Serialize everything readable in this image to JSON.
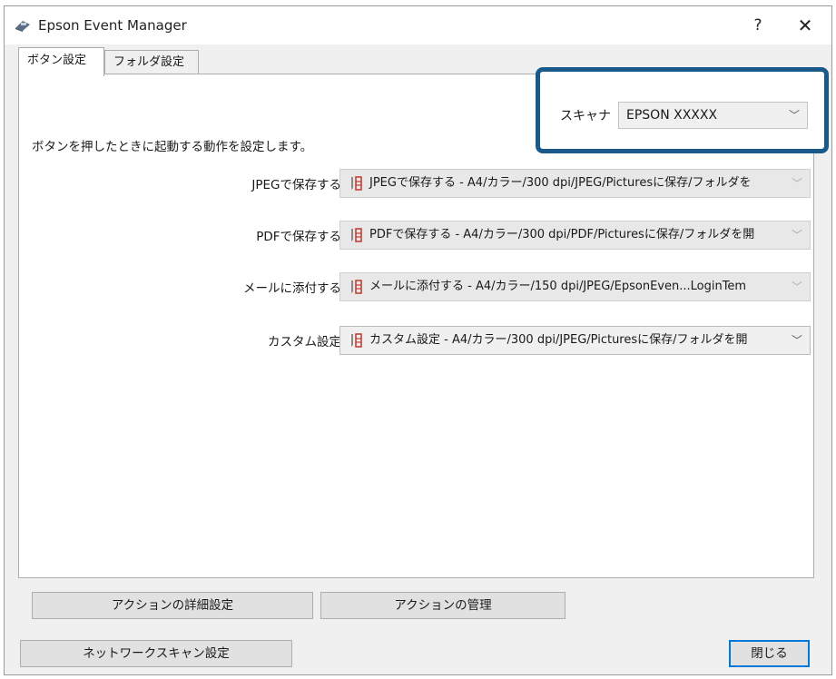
{
  "window": {
    "title": "Epson Event Manager",
    "help": "?",
    "close": "✕"
  },
  "tabs": [
    {
      "label": "ボタン設定",
      "active": true
    },
    {
      "label": "フォルダ設定",
      "active": false
    }
  ],
  "scanner": {
    "label": "スキャナ",
    "value": "EPSON XXXXX"
  },
  "instruction": "ボタンを押したときに起動する動作を設定します。",
  "actions": [
    {
      "label": "JPEGで保存する",
      "value": "JPEGで保存する - A4/カラー/300 dpi/JPEG/Picturesに保存/フォルダを",
      "enabled": false
    },
    {
      "label": "PDFで保存する",
      "value": "PDFで保存する - A4/カラー/300 dpi/PDF/Picturesに保存/フォルダを開",
      "enabled": false
    },
    {
      "label": "メールに添付する",
      "value": "メールに添付する - A4/カラー/150 dpi/JPEG/EpsonEven...LoginTem",
      "enabled": false
    },
    {
      "label": "カスタム設定",
      "value": "カスタム設定 - A4/カラー/300 dpi/JPEG/Picturesに保存/フォルダを開",
      "enabled": true
    }
  ],
  "buttons": {
    "detail": "アクションの詳細設定",
    "manage": "アクションの管理",
    "network": "ネットワークスキャン設定",
    "close": "閉じる"
  },
  "colors": {
    "highlight": "#1a5a8a",
    "focus": "#0078d7"
  }
}
